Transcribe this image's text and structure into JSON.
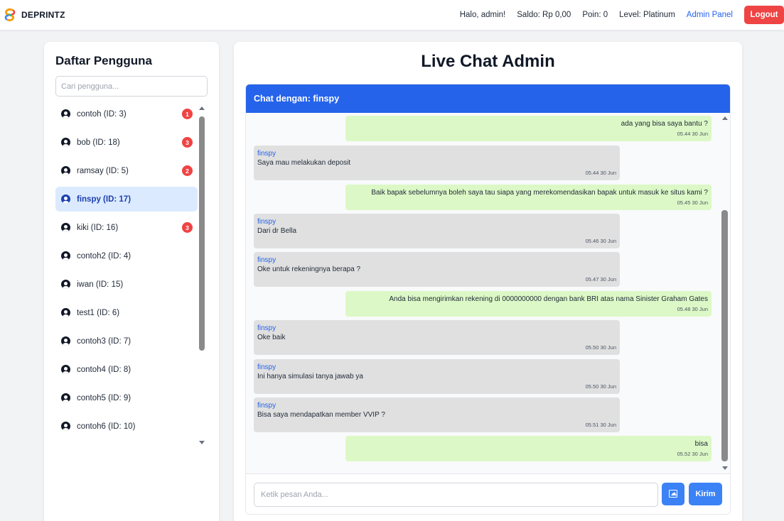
{
  "brand": {
    "name": "DEPRINTZ"
  },
  "nav": {
    "greeting": "Halo, admin!",
    "saldo": "Saldo: Rp 0,00",
    "poin": "Poin: 0",
    "level": "Level: Platinum",
    "admin_panel": "Admin Panel",
    "logout": "Logout"
  },
  "users_panel": {
    "title": "Daftar Pengguna",
    "search_placeholder": "Cari pengguna...",
    "users": [
      {
        "label": "contoh (ID: 3)",
        "badge": "1",
        "active": false
      },
      {
        "label": "bob (ID: 18)",
        "badge": "3",
        "active": false
      },
      {
        "label": "ramsay (ID: 5)",
        "badge": "2",
        "active": false
      },
      {
        "label": "finspy (ID: 17)",
        "badge": "",
        "active": true
      },
      {
        "label": "kiki (ID: 16)",
        "badge": "3",
        "active": false
      },
      {
        "label": "contoh2 (ID: 4)",
        "badge": "",
        "active": false
      },
      {
        "label": "iwan (ID: 15)",
        "badge": "",
        "active": false
      },
      {
        "label": "test1 (ID: 6)",
        "badge": "",
        "active": false
      },
      {
        "label": "contoh3 (ID: 7)",
        "badge": "",
        "active": false
      },
      {
        "label": "contoh4 (ID: 8)",
        "badge": "",
        "active": false
      },
      {
        "label": "contoh5 (ID: 9)",
        "badge": "",
        "active": false
      },
      {
        "label": "contoh6 (ID: 10)",
        "badge": "",
        "active": false
      }
    ]
  },
  "chat": {
    "title": "Live Chat Admin",
    "header": "Chat dengan: finspy",
    "messages": [
      {
        "dir": "out",
        "sender": "",
        "text": "ada yang bisa saya bantu ?",
        "time": "05.44 30 Jun"
      },
      {
        "dir": "in",
        "sender": "finspy",
        "text": "Saya mau melakukan deposit",
        "time": "05.44 30 Jun"
      },
      {
        "dir": "out",
        "sender": "",
        "text": "Baik bapak sebelumnya boleh saya tau siapa yang merekomendasikan bapak untuk masuk ke situs kami ?",
        "time": "05.45 30 Jun"
      },
      {
        "dir": "in",
        "sender": "finspy",
        "text": "Dari dr Bella",
        "time": "05.46 30 Jun"
      },
      {
        "dir": "in",
        "sender": "finspy",
        "text": "Oke untuk rekeningnya berapa ?",
        "time": "05.47 30 Jun"
      },
      {
        "dir": "out",
        "sender": "",
        "text": "Anda bisa mengirimkan rekening di 0000000000 dengan bank BRI atas nama Sinister Graham Gates",
        "time": "05.48 30 Jun"
      },
      {
        "dir": "in",
        "sender": "finspy",
        "text": "Oke baik",
        "time": "05.50 30 Jun"
      },
      {
        "dir": "in",
        "sender": "finspy",
        "text": "Ini hanya simulasi tanya jawab ya",
        "time": "05.50 30 Jun"
      },
      {
        "dir": "in",
        "sender": "finspy",
        "text": "Bisa saya mendapatkan member VVIP ?",
        "time": "05.51 30 Jun"
      },
      {
        "dir": "out",
        "sender": "",
        "text": "bisa",
        "time": "05.52 30 Jun"
      }
    ],
    "input_placeholder": "Ketik pesan Anda...",
    "send_label": "Kirim"
  }
}
